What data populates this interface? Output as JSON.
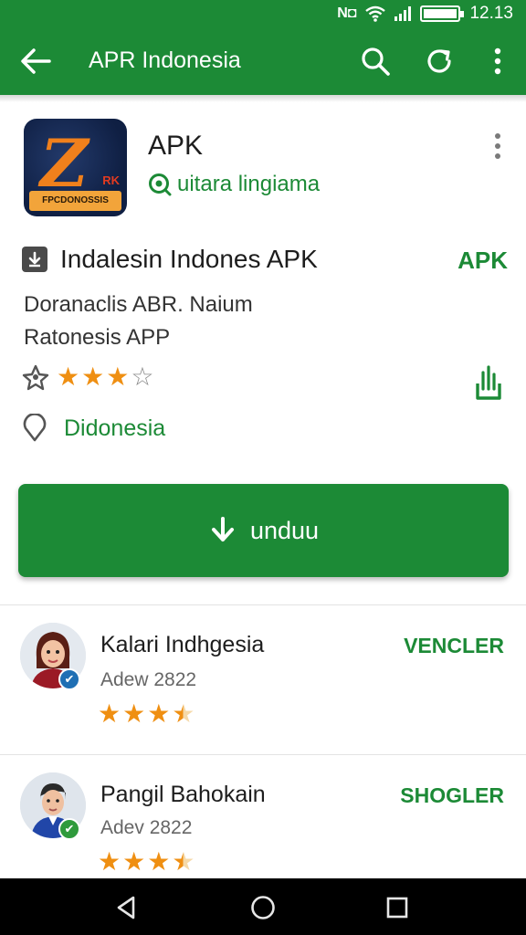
{
  "status_bar": {
    "time": "12.13"
  },
  "app_bar": {
    "title": "APR Indonesia"
  },
  "app": {
    "icon_strip_text": "FPCDONOSSIS",
    "icon_corner_text": "RK",
    "name": "APK",
    "developer": "uitara lingiama",
    "title_line": "Indalesin  Indones APK",
    "type_tag": "APK",
    "description_lines": [
      "Doranaclis  ABR. Naium",
      "Ratonesis APP"
    ],
    "rating": {
      "value": 3,
      "max": 4
    },
    "location": "Didonesia"
  },
  "install_button": {
    "label": "unduu"
  },
  "reviews": [
    {
      "name": "Kalari Indhgesia",
      "date": "Adew 2822",
      "rating": 3.5,
      "action": "VENCLER"
    },
    {
      "name": "Pangil Bahokain",
      "date": "Adev 2822",
      "rating": 3.5,
      "action": "SHOGLER"
    }
  ],
  "colors": {
    "primary": "#1c8a36",
    "star": "#ef8f12",
    "navbar": "#000000"
  },
  "icons": [
    "back-arrow-icon",
    "search-icon",
    "refresh-icon",
    "more-vert-icon",
    "download-icon",
    "share-icon",
    "location-pin-icon",
    "verified-badge-icon"
  ]
}
